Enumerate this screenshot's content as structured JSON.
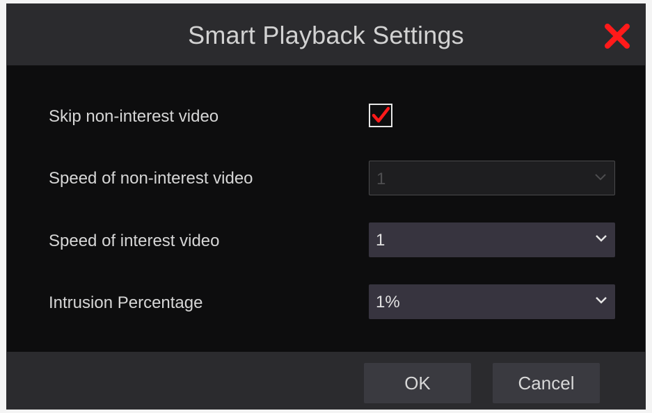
{
  "dialog": {
    "title": "Smart Playback Settings",
    "close_icon": "close-icon",
    "accent_color": "#ff1a1a"
  },
  "settings": {
    "skip_non_interest": {
      "label": "Skip non-interest video",
      "checked": true
    },
    "speed_non_interest": {
      "label": "Speed of non-interest video",
      "value": "1",
      "disabled": true
    },
    "speed_interest": {
      "label": "Speed of interest video",
      "value": "1"
    },
    "intrusion_percentage": {
      "label": "Intrusion Percentage",
      "value": "1%"
    }
  },
  "footer": {
    "ok_label": "OK",
    "cancel_label": "Cancel"
  }
}
